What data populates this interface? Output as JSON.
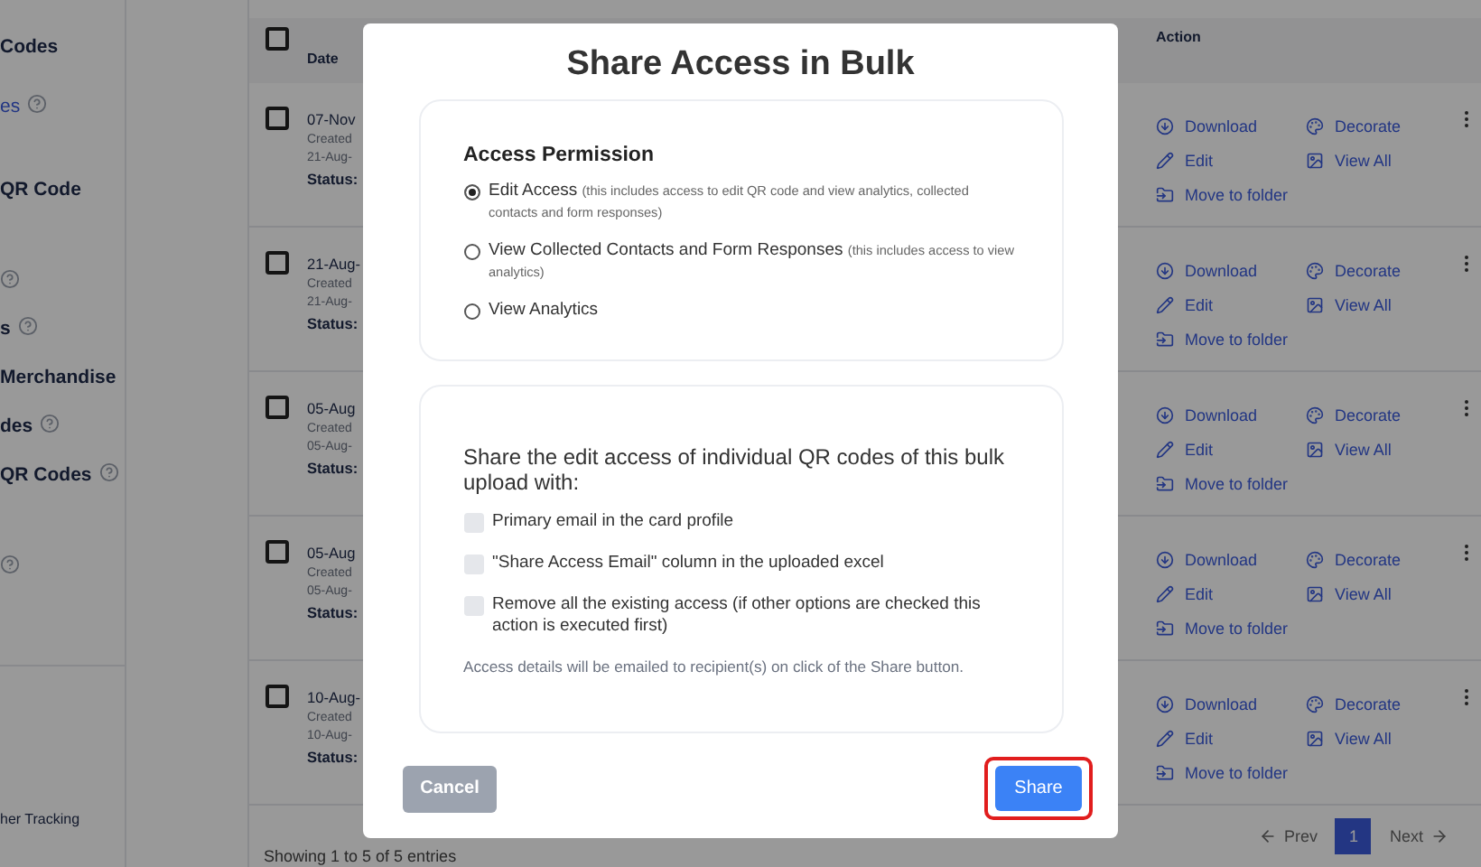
{
  "sidebar": {
    "items": [
      {
        "kind": "heading",
        "text": "Codes",
        "help": false
      },
      {
        "kind": "link",
        "text": "es",
        "help": true
      },
      {
        "kind": "heading",
        "text": "QR Code",
        "help": false
      },
      {
        "kind": "blank",
        "help": true
      },
      {
        "kind": "heading",
        "text": "s",
        "help": true
      },
      {
        "kind": "heading",
        "text": "Merchandise",
        "help": false
      },
      {
        "kind": "heading",
        "text": "des",
        "help": true
      },
      {
        "kind": "heading",
        "text": "QR Codes",
        "help": true
      },
      {
        "kind": "blank",
        "help": true
      }
    ],
    "footer": "her Tracking"
  },
  "table": {
    "columns": [
      "Date",
      "Action"
    ],
    "header_checked": false,
    "rows": [
      {
        "checked": false,
        "date": "07-Nov",
        "created": "Created",
        "created_date": "21-Aug-",
        "status": "Status:",
        "actions": [
          {
            "kind": "download",
            "label": "Download"
          },
          {
            "kind": "decorate",
            "label": "Decorate"
          },
          {
            "kind": "edit",
            "label": "Edit"
          },
          {
            "kind": "view",
            "label": "View All"
          },
          {
            "kind": "move",
            "label": "Move to folder"
          }
        ]
      },
      {
        "checked": false,
        "date": "21-Aug-",
        "created": "Created",
        "created_date": "21-Aug-",
        "status": "Status:",
        "actions": [
          {
            "kind": "download",
            "label": "Download"
          },
          {
            "kind": "decorate",
            "label": "Decorate"
          },
          {
            "kind": "edit",
            "label": "Edit"
          },
          {
            "kind": "view",
            "label": "View All"
          },
          {
            "kind": "move",
            "label": "Move to folder"
          }
        ]
      },
      {
        "checked": false,
        "date": "05-Aug",
        "created": "Created",
        "created_date": "05-Aug-",
        "status": "Status:",
        "actions": [
          {
            "kind": "download",
            "label": "Download"
          },
          {
            "kind": "decorate",
            "label": "Decorate"
          },
          {
            "kind": "edit",
            "label": "Edit"
          },
          {
            "kind": "view",
            "label": "View All"
          },
          {
            "kind": "move",
            "label": "Move to folder"
          }
        ]
      },
      {
        "checked": false,
        "date": "05-Aug",
        "created": "Created",
        "created_date": "05-Aug-",
        "status": "Status:",
        "actions": [
          {
            "kind": "download",
            "label": "Download"
          },
          {
            "kind": "decorate",
            "label": "Decorate"
          },
          {
            "kind": "edit",
            "label": "Edit"
          },
          {
            "kind": "view",
            "label": "View All"
          },
          {
            "kind": "move",
            "label": "Move to folder"
          }
        ]
      },
      {
        "checked": false,
        "date": "10-Aug-",
        "created": "Created",
        "created_date": "10-Aug-",
        "status": "Status:",
        "actions": [
          {
            "kind": "download",
            "label": "Download"
          },
          {
            "kind": "decorate",
            "label": "Decorate"
          },
          {
            "kind": "edit",
            "label": "Edit"
          },
          {
            "kind": "view",
            "label": "View All"
          },
          {
            "kind": "move",
            "label": "Move to folder"
          }
        ]
      }
    ]
  },
  "footer": {
    "info": "Showing 1 to 5 of 5 entries",
    "prev": "Prev",
    "pages": [
      {
        "label": "1",
        "selected": true
      }
    ],
    "next": "Next"
  },
  "dialog": {
    "title": "Share Access in Bulk",
    "permission": {
      "heading": "Access Permission",
      "options": [
        {
          "label": "Edit Access",
          "note": "(this includes access to edit QR code and view analytics, collected contacts and form responses)",
          "selected": true
        },
        {
          "label": "View Collected Contacts and Form Responses",
          "note": "(this includes access to view analytics)",
          "selected": false
        },
        {
          "label": "View Analytics",
          "selected": false
        }
      ]
    },
    "share_with": {
      "heading": "Share the edit access of individual QR codes of this bulk upload with:",
      "options": [
        {
          "label": "Primary email in the card profile",
          "checked": false
        },
        {
          "label": "\"Share Access Email\" column in the uploaded excel",
          "checked": false
        },
        {
          "label": "Remove all the existing access (if other options are checked this action is executed first)",
          "checked": false
        }
      ],
      "note": "Access details will be emailed to recipient(s) on click of the Share button."
    },
    "cancel": "Cancel",
    "share": "Share",
    "share_highlighted": true
  }
}
